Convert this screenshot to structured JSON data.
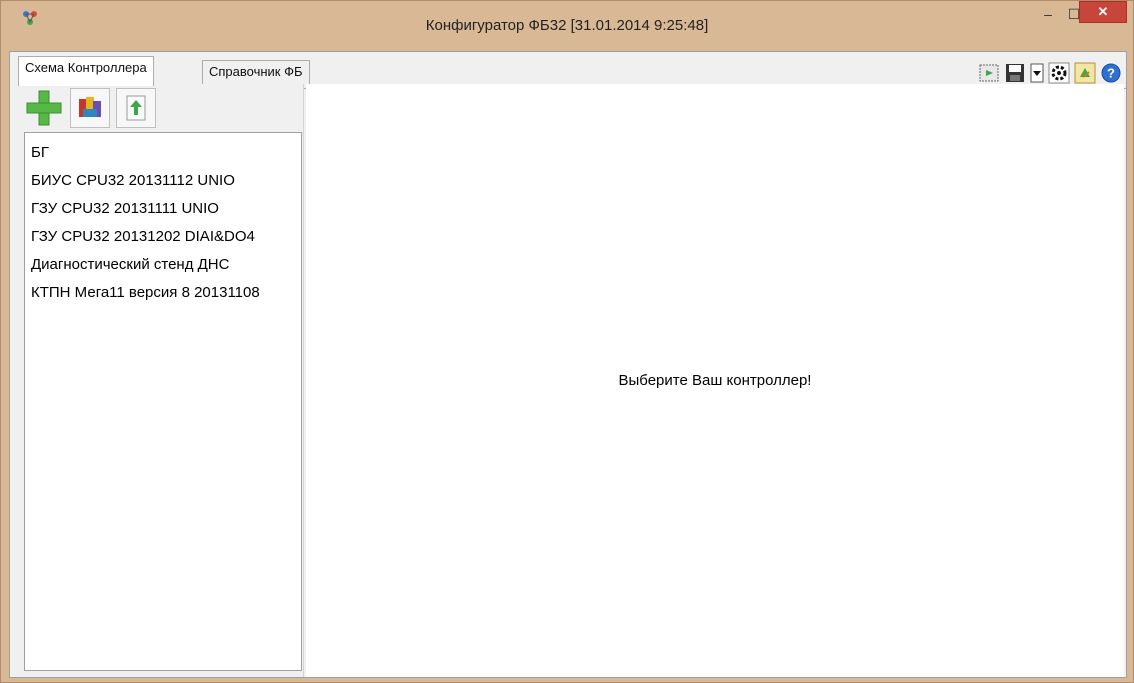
{
  "window": {
    "title": "Конфигуратор ФБ32 [31.01.2014 9:25:48]",
    "controls": {
      "minimize": "‒",
      "maximize": "☐",
      "close": "✕"
    }
  },
  "tabs": [
    {
      "label": "Схема Контроллера",
      "active": true
    },
    {
      "label": "Справочник ФБ",
      "active": false
    }
  ],
  "toolbar_right": {
    "icons": [
      "export-icon",
      "save-icon",
      "dropdown-arrow-icon",
      "settings-icon",
      "refresh-icon",
      "help-icon"
    ]
  },
  "toolbar_left": {
    "icons": [
      "add-icon",
      "library-icon",
      "upload-icon"
    ]
  },
  "controllers": [
    "БГ",
    "БИУС CPU32 20131112 UNIO",
    "ГЗУ CPU32 20131111 UNIO",
    "ГЗУ CPU32 20131202 DIAI&DO4",
    "Диагностический стенд ДНС",
    "КТПН Мега11 версия 8 20131108"
  ],
  "main": {
    "hint": "Выберите Ваш контроллер!"
  },
  "colors": {
    "title_bar": "#d9b896",
    "close_button": "#c7453a",
    "accent_green": "#57b847"
  }
}
